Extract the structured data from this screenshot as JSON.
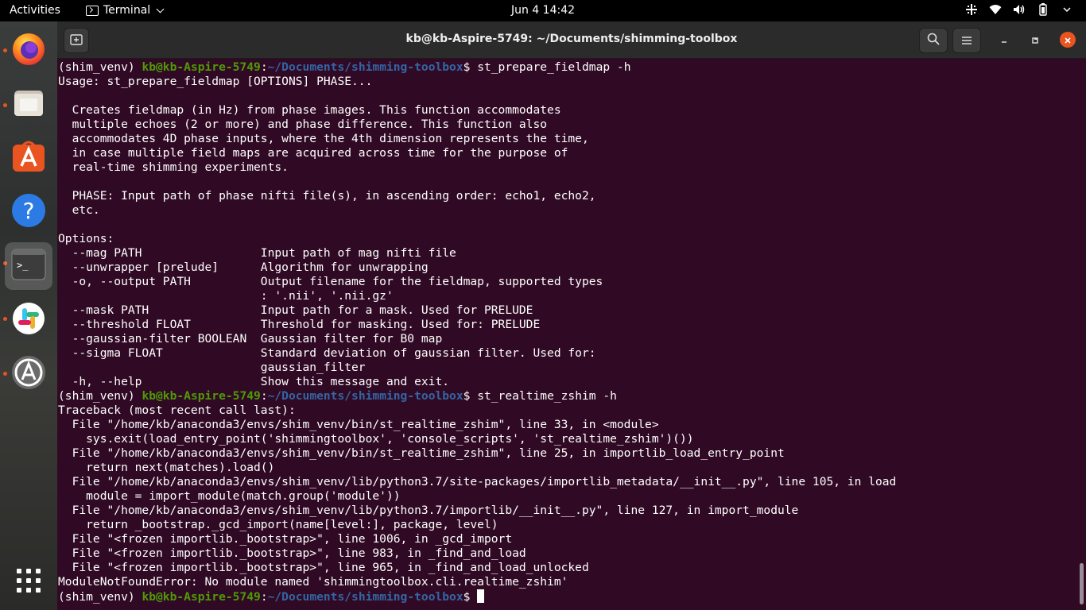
{
  "topbar": {
    "activities": "Activities",
    "app_name": "Terminal",
    "clock": "Jun 4  14:42"
  },
  "dock": {
    "items": [
      {
        "name": "Firefox",
        "icon": "firefox-icon"
      },
      {
        "name": "Files",
        "icon": "files-icon"
      },
      {
        "name": "Ubuntu Software",
        "icon": "software-icon"
      },
      {
        "name": "Help",
        "icon": "help-icon"
      },
      {
        "name": "Terminal",
        "icon": "terminal-icon"
      },
      {
        "name": "Slack",
        "icon": "slack-icon"
      },
      {
        "name": "Software Updater",
        "icon": "updater-icon"
      }
    ],
    "show_apps_icon": "grid-icon"
  },
  "window": {
    "title": "kb@kb-Aspire-5749: ~/Documents/shimming-toolbox"
  },
  "colors": {
    "terminal_bg": "#300a24",
    "prompt_host": "#4e9a06",
    "prompt_path": "#3465a4",
    "accent": "#e95420"
  },
  "terminal": {
    "prompts": [
      {
        "venv": "(shim_venv) ",
        "host": "kb@kb-Aspire-5749",
        "sep": ":",
        "path": "~/Documents/shimming-toolbox",
        "dollar": "$ ",
        "cmd": "st_prepare_fieldmap -h"
      },
      {
        "venv": "(shim_venv) ",
        "host": "kb@kb-Aspire-5749",
        "sep": ":",
        "path": "~/Documents/shimming-toolbox",
        "dollar": "$ ",
        "cmd": "st_realtime_zshim -h"
      },
      {
        "venv": "(shim_venv) ",
        "host": "kb@kb-Aspire-5749",
        "sep": ":",
        "path": "~/Documents/shimming-toolbox",
        "dollar": "$ ",
        "cmd": ""
      }
    ],
    "help_output": [
      "Usage: st_prepare_fieldmap [OPTIONS] PHASE...",
      "",
      "  Creates fieldmap (in Hz) from phase images. This function accommodates",
      "  multiple echoes (2 or more) and phase difference. This function also",
      "  accommodates 4D phase inputs, where the 4th dimension represents the time,",
      "  in case multiple field maps are acquired across time for the purpose of",
      "  real-time shimming experiments.",
      "",
      "  PHASE: Input path of phase nifti file(s), in ascending order: echo1, echo2,",
      "  etc.",
      "",
      "Options:",
      "  --mag PATH                 Input path of mag nifti file",
      "  --unwrapper [prelude]      Algorithm for unwrapping",
      "  -o, --output PATH          Output filename for the fieldmap, supported types",
      "                             : '.nii', '.nii.gz'",
      "  --mask PATH                Input path for a mask. Used for PRELUDE",
      "  --threshold FLOAT          Threshold for masking. Used for: PRELUDE",
      "  --gaussian-filter BOOLEAN  Gaussian filter for B0 map",
      "  --sigma FLOAT              Standard deviation of gaussian filter. Used for:",
      "                             gaussian_filter",
      "  -h, --help                 Show this message and exit."
    ],
    "traceback_output": [
      "Traceback (most recent call last):",
      "  File \"/home/kb/anaconda3/envs/shim_venv/bin/st_realtime_zshim\", line 33, in <module>",
      "    sys.exit(load_entry_point('shimmingtoolbox', 'console_scripts', 'st_realtime_zshim')())",
      "  File \"/home/kb/anaconda3/envs/shim_venv/bin/st_realtime_zshim\", line 25, in importlib_load_entry_point",
      "    return next(matches).load()",
      "  File \"/home/kb/anaconda3/envs/shim_venv/lib/python3.7/site-packages/importlib_metadata/__init__.py\", line 105, in load",
      "    module = import_module(match.group('module'))",
      "  File \"/home/kb/anaconda3/envs/shim_venv/lib/python3.7/importlib/__init__.py\", line 127, in import_module",
      "    return _bootstrap._gcd_import(name[level:], package, level)",
      "  File \"<frozen importlib._bootstrap>\", line 1006, in _gcd_import",
      "  File \"<frozen importlib._bootstrap>\", line 983, in _find_and_load",
      "  File \"<frozen importlib._bootstrap>\", line 965, in _find_and_load_unlocked",
      "ModuleNotFoundError: No module named 'shimmingtoolbox.cli.realtime_zshim'"
    ]
  }
}
